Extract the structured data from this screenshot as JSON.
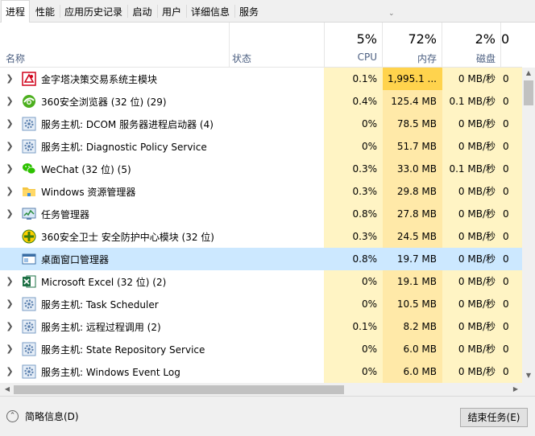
{
  "tabs": [
    {
      "label": "进程",
      "active": true
    },
    {
      "label": "性能"
    },
    {
      "label": "应用历史记录"
    },
    {
      "label": "启动"
    },
    {
      "label": "用户"
    },
    {
      "label": "详细信息"
    },
    {
      "label": "服务"
    }
  ],
  "columns": {
    "name": "名称",
    "status": "状态",
    "cpu": {
      "pct": "5%",
      "label": "CPU"
    },
    "memory": {
      "pct": "72%",
      "label": "内存"
    },
    "disk": {
      "pct": "2%",
      "label": "磁盘"
    },
    "network": {
      "label": "0"
    }
  },
  "processes": [
    {
      "name": "金字塔决策交易系统主模块",
      "icon": "pyramid-app-icon",
      "expandable": true,
      "cpu": "0.1%",
      "mem": "1,995.1 ...",
      "disk": "0 MB/秒",
      "net": "0"
    },
    {
      "name": "360安全浏览器 (32 位) (29)",
      "icon": "browser-360-icon",
      "expandable": true,
      "cpu": "0.4%",
      "mem": "125.4 MB",
      "disk": "0.1 MB/秒",
      "net": "0"
    },
    {
      "name": "服务主机: DCOM 服务器进程启动器 (4)",
      "icon": "service-gear-icon",
      "expandable": true,
      "cpu": "0%",
      "mem": "78.5 MB",
      "disk": "0 MB/秒",
      "net": "0"
    },
    {
      "name": "服务主机: Diagnostic Policy Service",
      "icon": "service-gear-icon",
      "expandable": true,
      "cpu": "0%",
      "mem": "51.7 MB",
      "disk": "0 MB/秒",
      "net": "0"
    },
    {
      "name": "WeChat (32 位) (5)",
      "icon": "wechat-icon",
      "expandable": true,
      "cpu": "0.3%",
      "mem": "33.0 MB",
      "disk": "0.1 MB/秒",
      "net": "0"
    },
    {
      "name": "Windows 资源管理器",
      "icon": "folder-icon",
      "expandable": true,
      "cpu": "0.3%",
      "mem": "29.8 MB",
      "disk": "0 MB/秒",
      "net": "0"
    },
    {
      "name": "任务管理器",
      "icon": "task-manager-icon",
      "expandable": true,
      "cpu": "0.8%",
      "mem": "27.8 MB",
      "disk": "0 MB/秒",
      "net": "0"
    },
    {
      "name": "360安全卫士 安全防护中心模块 (32 位)",
      "icon": "shield-360-icon",
      "expandable": false,
      "cpu": "0.3%",
      "mem": "24.5 MB",
      "disk": "0 MB/秒",
      "net": "0"
    },
    {
      "name": "桌面窗口管理器",
      "icon": "window-icon",
      "expandable": false,
      "cpu": "0.8%",
      "mem": "19.7 MB",
      "disk": "0 MB/秒",
      "net": "0",
      "selected": true
    },
    {
      "name": "Microsoft Excel (32 位) (2)",
      "icon": "excel-icon",
      "expandable": true,
      "cpu": "0%",
      "mem": "19.1 MB",
      "disk": "0 MB/秒",
      "net": "0"
    },
    {
      "name": "服务主机: Task Scheduler",
      "icon": "service-gear-icon",
      "expandable": true,
      "cpu": "0%",
      "mem": "10.5 MB",
      "disk": "0 MB/秒",
      "net": "0"
    },
    {
      "name": "服务主机: 远程过程调用 (2)",
      "icon": "service-gear-icon",
      "expandable": true,
      "cpu": "0.1%",
      "mem": "8.2 MB",
      "disk": "0 MB/秒",
      "net": "0"
    },
    {
      "name": "服务主机: State Repository Service",
      "icon": "service-gear-icon",
      "expandable": true,
      "cpu": "0%",
      "mem": "6.0 MB",
      "disk": "0 MB/秒",
      "net": "0"
    },
    {
      "name": "服务主机: Windows Event Log",
      "icon": "service-gear-icon",
      "expandable": true,
      "cpu": "0%",
      "mem": "6.0 MB",
      "disk": "0 MB/秒",
      "net": "0"
    }
  ],
  "footer": {
    "fewer_details": "简略信息(D)",
    "end_task": "结束任务(E)"
  },
  "colors": {
    "cpu_bg": "#fff4c4",
    "mem_bg": "#ffe9a8",
    "mem_high_bg": "#ffd34d",
    "selected_bg": "#cce8ff",
    "header_label": "#4d6082"
  }
}
